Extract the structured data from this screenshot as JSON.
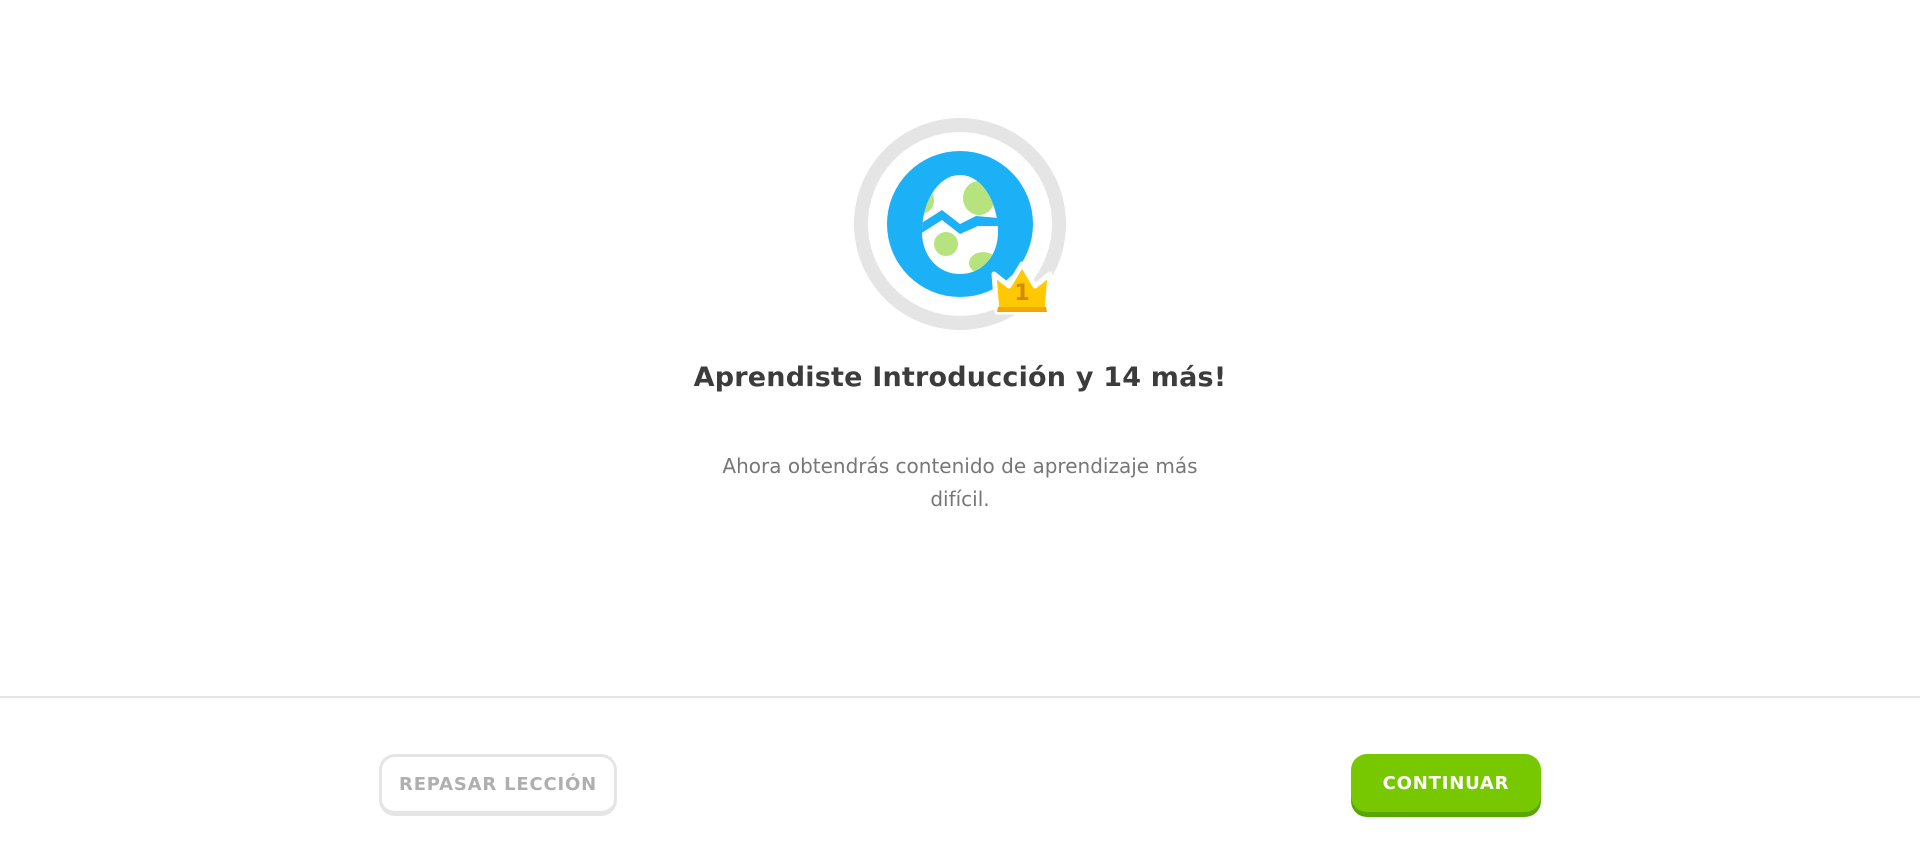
{
  "lesson_complete": {
    "badge": {
      "icon": "egg-icon",
      "crown_icon": "crown-icon",
      "crown_level": "1",
      "colors": {
        "ring": "#e5e5e5",
        "circle": "#1cb0f6",
        "egg": "#ffffff",
        "egg_spots": "#b7e37f",
        "egg_crack": "#1cb0f6",
        "crown": "#ffc800",
        "crown_text": "#d48a00"
      }
    },
    "title": "Aprendiste Introducción y 14 más!",
    "subtitle": "Ahora obtendrás contenido de aprendizaje más difícil."
  },
  "footer": {
    "review_button_label": "REPASAR LECCIÓN",
    "continue_button_label": "CONTINUAR",
    "colors": {
      "continue": "#78c800",
      "continue_shadow": "#58a700",
      "review_text": "#afafaf"
    }
  }
}
